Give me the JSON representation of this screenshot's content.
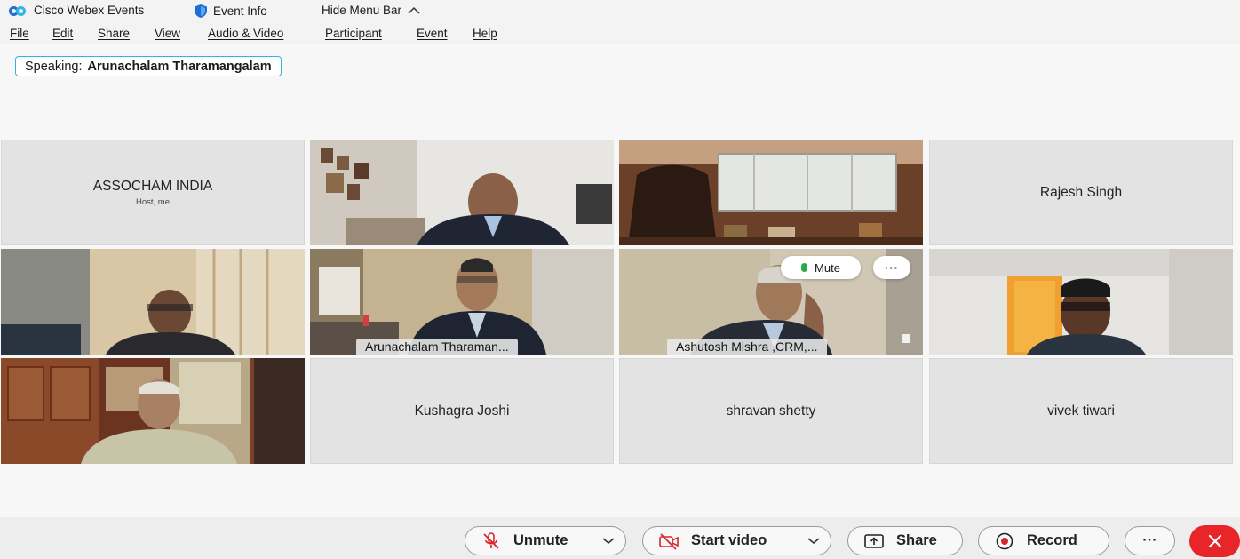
{
  "titlebar": {
    "app_name": "Cisco Webex Events",
    "event_info": "Event Info",
    "hide_menu": "Hide Menu Bar"
  },
  "menu": [
    "File",
    "Edit",
    "Share",
    "View",
    "Audio & Video",
    "Participant",
    "Event",
    "Help"
  ],
  "speaking": {
    "label": "Speaking:",
    "name": "Arunachalam Tharamangalam"
  },
  "tiles": {
    "assocham": {
      "name": "ASSOCHAM INDIA",
      "sub": "Host, me"
    },
    "rajesh": {
      "name": "Rajesh Singh"
    },
    "arunachalam": {
      "tag": "Arunachalam Tharaman..."
    },
    "ashutosh": {
      "tag": "Ashutosh Mishra ,CRM,...",
      "mute_label": "Mute",
      "more_label": "···"
    },
    "kushagra": {
      "name": "Kushagra Joshi"
    },
    "shravan": {
      "name": "shravan shetty"
    },
    "vivek": {
      "name": "vivek tiwari"
    }
  },
  "controls": {
    "unmute": "Unmute",
    "start_video": "Start video",
    "share": "Share",
    "record": "Record",
    "more": "···"
  },
  "colors": {
    "accent": "#18a0d8",
    "leave": "#e8262a",
    "mic_active": "#2aa84a"
  },
  "icons": [
    "webex-logo",
    "shield-icon",
    "chevron-up-icon",
    "mic-off-icon",
    "video-off-icon",
    "share-screen-icon",
    "record-icon",
    "more-icon",
    "close-icon"
  ]
}
